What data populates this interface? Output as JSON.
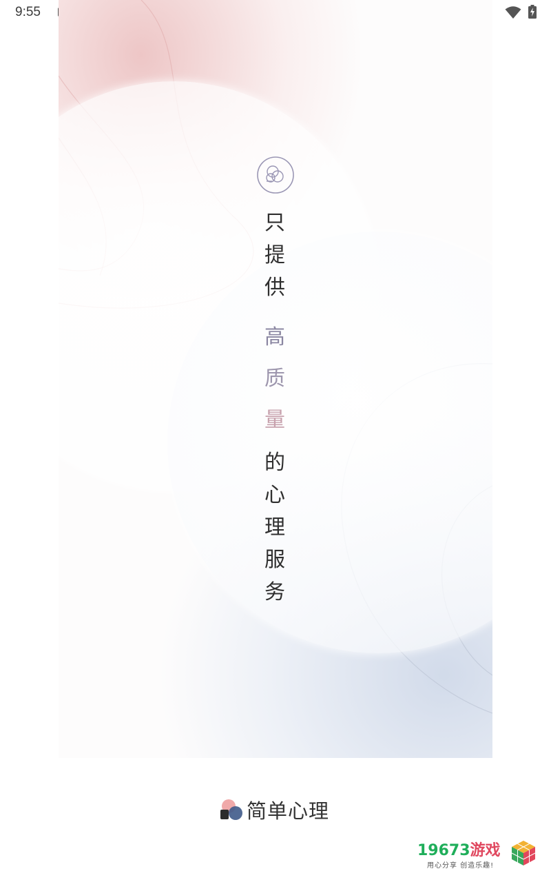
{
  "status_bar": {
    "time": "9:55",
    "notification_glyph": "A",
    "icons": [
      "wifi-icon",
      "battery-charging-icon"
    ]
  },
  "splash": {
    "slogan_line1": [
      "只",
      "提",
      "供"
    ],
    "slogan_highlight": [
      "高",
      "质",
      "量"
    ],
    "slogan_line3": [
      "的",
      "心",
      "理",
      "服",
      "务"
    ],
    "highlight_colors": [
      "#8a86a1",
      "#9d96ad",
      "#c7a1ad"
    ]
  },
  "app": {
    "name": "简单心理",
    "logo_icon": "brand-logo-icon"
  },
  "watermark": {
    "number": "19673",
    "name": "游戏",
    "slogan": "用心分享 创造乐趣!"
  }
}
